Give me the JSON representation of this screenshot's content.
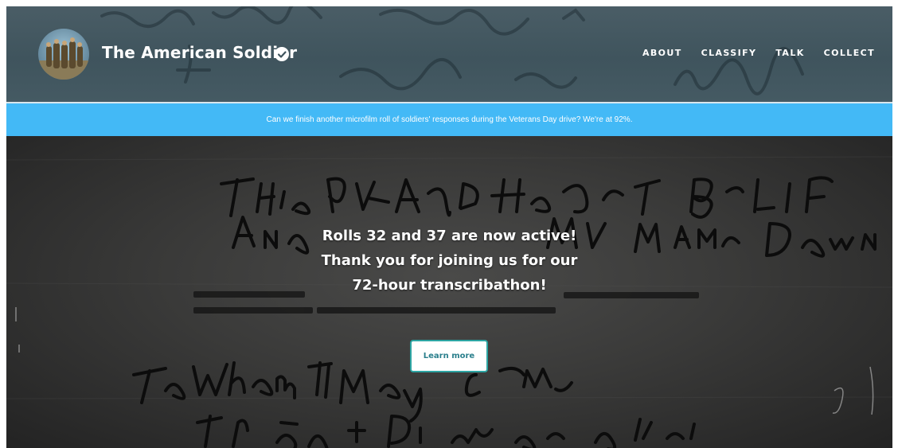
{
  "header": {
    "title": "The American Soldier",
    "verified_icon": "check-circle-icon",
    "avatar_icon": "soldiers-avatar-image",
    "nav": [
      {
        "label": "ABOUT"
      },
      {
        "label": "CLASSIFY"
      },
      {
        "label": "TALK"
      },
      {
        "label": "COLLECT"
      }
    ]
  },
  "banner": {
    "text": "Can we finish another microfilm roll of soldiers' responses during the Veterans Day drive? We're at 92%.",
    "color": "#43b9f6"
  },
  "hero": {
    "lines": [
      "Rolls 32 and 37 are now active!",
      "Thank you for joining us for our",
      "72-hour transcribathon!"
    ],
    "button_label": "Learn more",
    "accent": "#2da5a3"
  }
}
